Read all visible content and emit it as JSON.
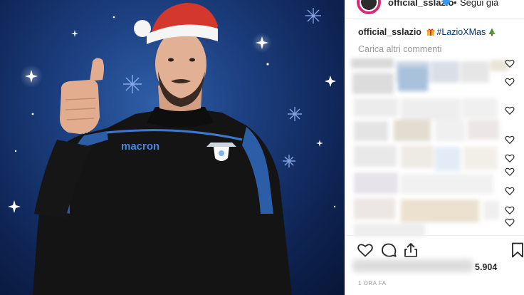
{
  "post": {
    "username": "official_sslazio",
    "follow_label": "Segui già",
    "separator": "•",
    "caption_user": "official_sslazio",
    "caption_hashtag": "#LazioXMas",
    "load_more_label": "Carica altri commenti",
    "likes_count": "5.904",
    "time_ago": "1 ORA FA"
  },
  "media": {
    "jersey_brand": "macron"
  },
  "icons": {
    "like": "heart-icon",
    "comment": "comment-icon",
    "share": "share-icon",
    "save": "bookmark-icon",
    "comment_like": "small-heart-icon"
  },
  "colors": {
    "hashtag": "#003569",
    "muted": "#999999",
    "text": "#262626",
    "verified": "#3897f0",
    "background_blue": "#1c3f80"
  }
}
